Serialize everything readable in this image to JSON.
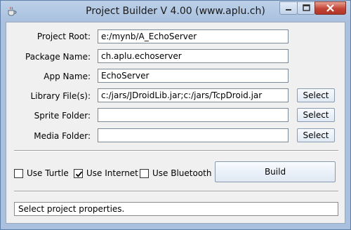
{
  "window": {
    "title": "Project Builder V 4.00 (www.aplu.ch)",
    "app_icon": "java-cup-icon",
    "controls": [
      "minimize-icon",
      "maximize-icon",
      "close-icon"
    ]
  },
  "form": {
    "project_root": {
      "label": "Project Root:",
      "value": "e:/mynb/A_EchoServer"
    },
    "package_name": {
      "label": "Package Name:",
      "value": "ch.aplu.echoserver"
    },
    "app_name": {
      "label": "App Name:",
      "value": "EchoServer"
    },
    "library_files": {
      "label": "Library File(s):",
      "value": "c:/jars/JDroidLib.jar;c:/jars/TcpDroid.jar",
      "button": "Select"
    },
    "sprite_folder": {
      "label": "Sprite Folder:",
      "value": "",
      "button": "Select"
    },
    "media_folder": {
      "label": "Media Folder:",
      "value": "",
      "button": "Select"
    }
  },
  "options": {
    "use_turtle": {
      "label": "Use Turtle",
      "checked": false
    },
    "use_internet": {
      "label": "Use Internet",
      "checked": true
    },
    "use_bluetooth": {
      "label": "Use Bluetooth",
      "checked": false
    }
  },
  "build_button": "Build",
  "status": "Select project properties.",
  "colors": {
    "titlebar": "#a9c1df",
    "close_button": "#c24536",
    "client_bg": "#f0f0f0"
  }
}
